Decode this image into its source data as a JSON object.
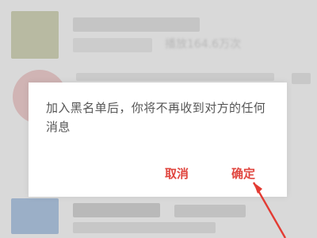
{
  "dialog": {
    "message": "加入黑名单后，你将不再收到对方的任何消息",
    "cancel_label": "取消",
    "confirm_label": "确定"
  },
  "background": {
    "blurred_text": "播放164.6万次"
  },
  "colors": {
    "accent": "#e0463f"
  }
}
